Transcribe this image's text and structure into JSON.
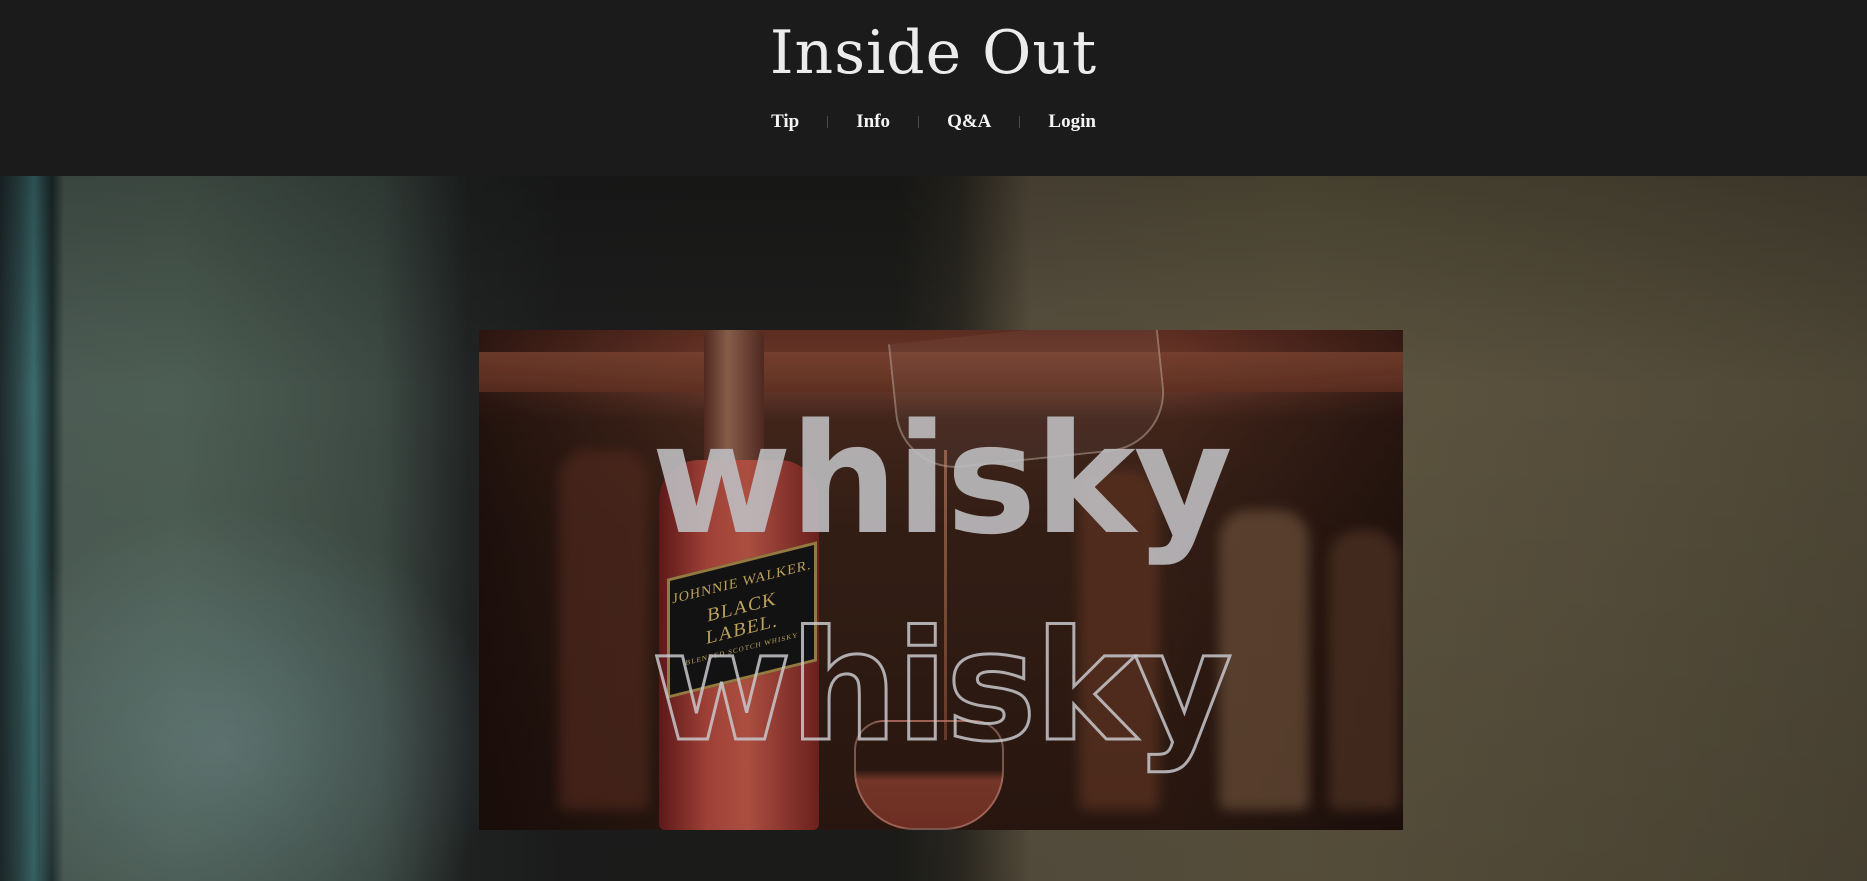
{
  "header": {
    "title": "Inside Out",
    "nav": [
      "Tip",
      "Info",
      "Q&A",
      "Login"
    ]
  },
  "hero": {
    "headline_solid": "whisky",
    "headline_outline": "whisky",
    "bottle_label": {
      "line1": "JOHNNIE WALKER.",
      "line2": "BLACK LABEL.",
      "line3": "BLENDED SCOTCH WHISKY"
    }
  },
  "colors": {
    "header_bg": "#1b1b1b",
    "title_text": "#ececec",
    "nav_text": "#f4f4f4"
  }
}
